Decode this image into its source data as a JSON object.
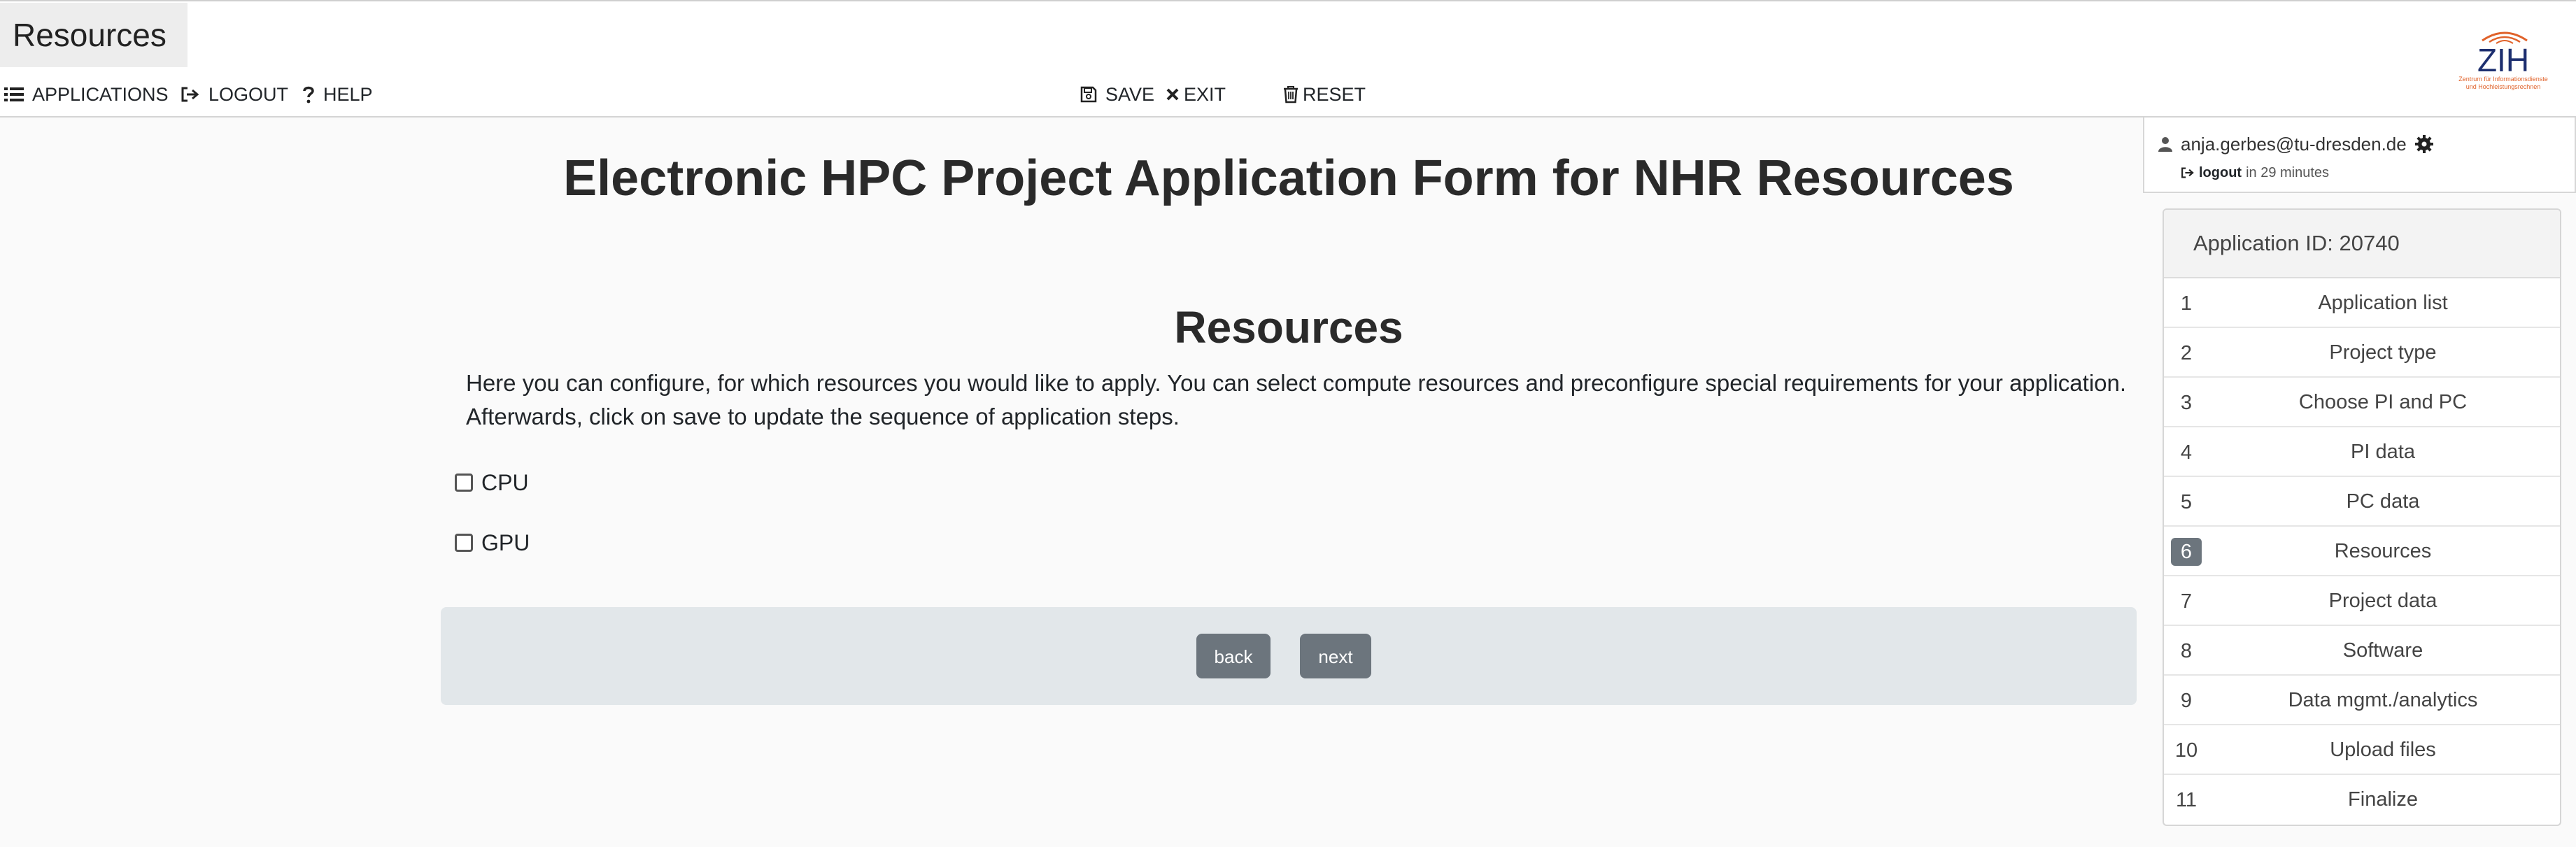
{
  "page_tab": "Resources",
  "toolbar": {
    "applications": "APPLICATIONS",
    "logout": "LOGOUT",
    "help": "HELP",
    "save": "SAVE",
    "exit": "EXIT",
    "reset": "RESET"
  },
  "logo": {
    "text": "ZIH",
    "subtitle_line1": "Zentrum für Informationsdienste",
    "subtitle_line2": "und Hochleistungsrechnen"
  },
  "user": {
    "email": "anja.gerbes@tu-dresden.de",
    "logout_label": "logout",
    "logout_timer": "in 29 minutes"
  },
  "main": {
    "title": "Electronic HPC Project Application Form for NHR Resources",
    "section_title": "Resources",
    "description": "Here you can configure, for which resources you would like to apply. You can select compute resources and preconfigure special requirements for your application. Afterwards, click on save to update the sequence of application steps.",
    "options": [
      {
        "label": "CPU",
        "checked": false
      },
      {
        "label": "GPU",
        "checked": false
      }
    ],
    "back_label": "back",
    "next_label": "next"
  },
  "sidebar": {
    "header": "Application ID: 20740",
    "steps": [
      {
        "num": "1",
        "label": "Application list"
      },
      {
        "num": "2",
        "label": "Project type"
      },
      {
        "num": "3",
        "label": "Choose PI and PC"
      },
      {
        "num": "4",
        "label": "PI data"
      },
      {
        "num": "5",
        "label": "PC data"
      },
      {
        "num": "6",
        "label": "Resources"
      },
      {
        "num": "7",
        "label": "Project data"
      },
      {
        "num": "8",
        "label": "Software"
      },
      {
        "num": "9",
        "label": "Data mgmt./analytics"
      },
      {
        "num": "10",
        "label": "Upload files"
      },
      {
        "num": "11",
        "label": "Finalize"
      }
    ],
    "active_step": "6"
  },
  "colors": {
    "accent": "#6c757d",
    "panel": "#e2e7ea",
    "logo_blue": "#1d2f6f",
    "logo_orange": "#e0622a"
  }
}
